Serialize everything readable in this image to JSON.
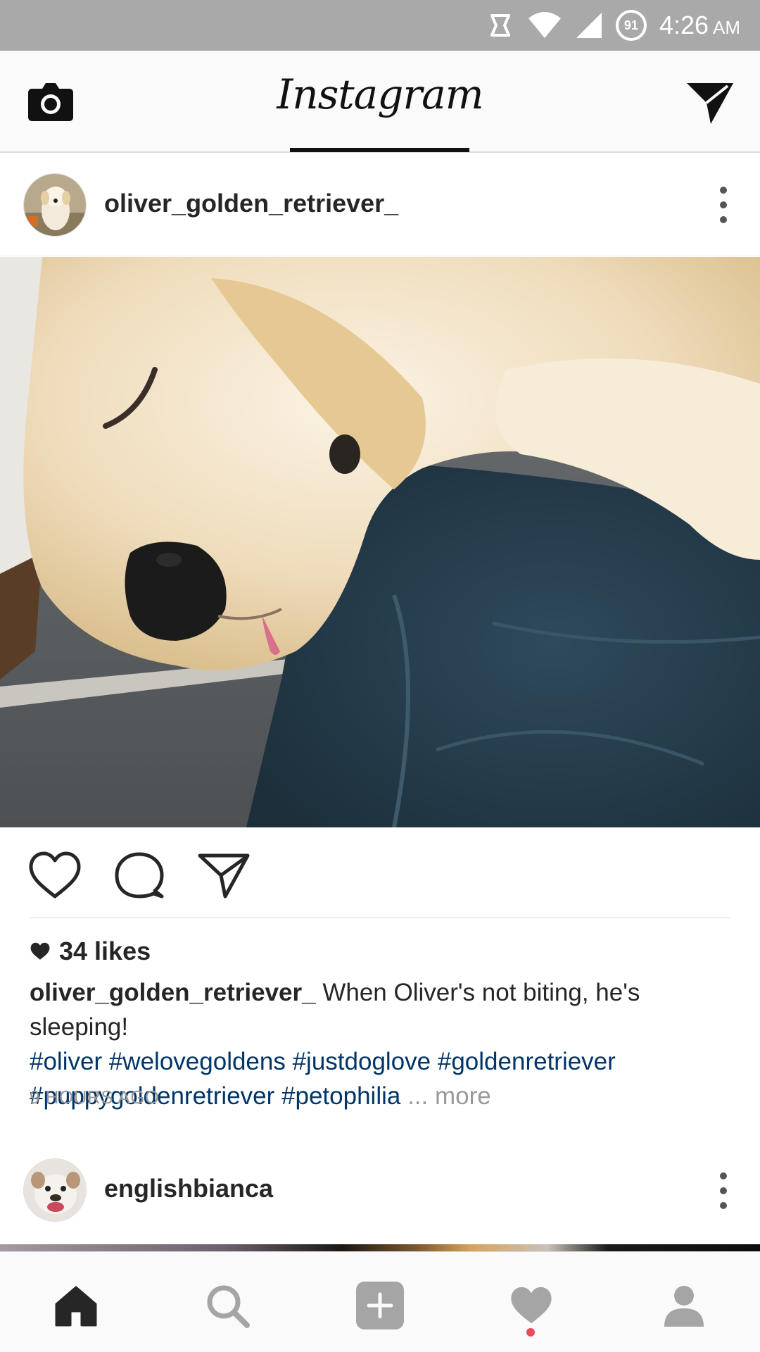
{
  "status_bar": {
    "time": "4:26",
    "ampm": "AM",
    "battery": "91"
  },
  "app": {
    "title": "Instagram"
  },
  "post": {
    "username": "oliver_golden_retriever_",
    "likes": "34 likes",
    "caption_user": "oliver_golden_retriever_",
    "caption_text": " When Oliver's not biting, he's sleeping!",
    "hashtags_line1": [
      "#oliver",
      "#welovegoldens",
      "#justdoglove",
      "#goldenretriever"
    ],
    "hashtags_line2": [
      "#puppygoldenretriever",
      "#petophilia"
    ],
    "more_label": "... more",
    "timestamp": "9 HOURS AGO"
  },
  "next_post": {
    "username": "englishbianca"
  },
  "nav": {
    "items": [
      "home-icon",
      "search-icon",
      "add-icon",
      "activity-icon",
      "profile-icon"
    ],
    "activity_dot_color": "#ed4956"
  },
  "colors": {
    "hashtag": "#003569",
    "text": "#262626",
    "muted": "#999999",
    "status_bar": "#a9a9a9"
  }
}
